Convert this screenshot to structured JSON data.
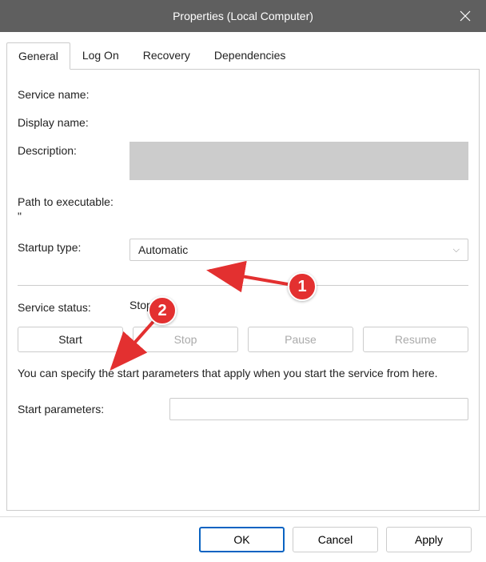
{
  "window": {
    "title": "Properties (Local Computer)"
  },
  "tabs": {
    "general": "General",
    "logon": "Log On",
    "recovery": "Recovery",
    "dependencies": "Dependencies"
  },
  "labels": {
    "service_name": "Service name:",
    "display_name": "Display name:",
    "description": "Description:",
    "path": "Path to executable:",
    "path_value": "\"",
    "startup_type": "Startup type:",
    "service_status": "Service status:",
    "start_parameters": "Start parameters:"
  },
  "values": {
    "startup_type": "Automatic",
    "service_status": "Stopped",
    "start_parameters": ""
  },
  "svc_buttons": {
    "start": "Start",
    "stop": "Stop",
    "pause": "Pause",
    "resume": "Resume"
  },
  "hint": "You can specify the start parameters that apply when you start the service from here.",
  "footer": {
    "ok": "OK",
    "cancel": "Cancel",
    "apply": "Apply"
  },
  "annotations": {
    "one": "1",
    "two": "2"
  }
}
